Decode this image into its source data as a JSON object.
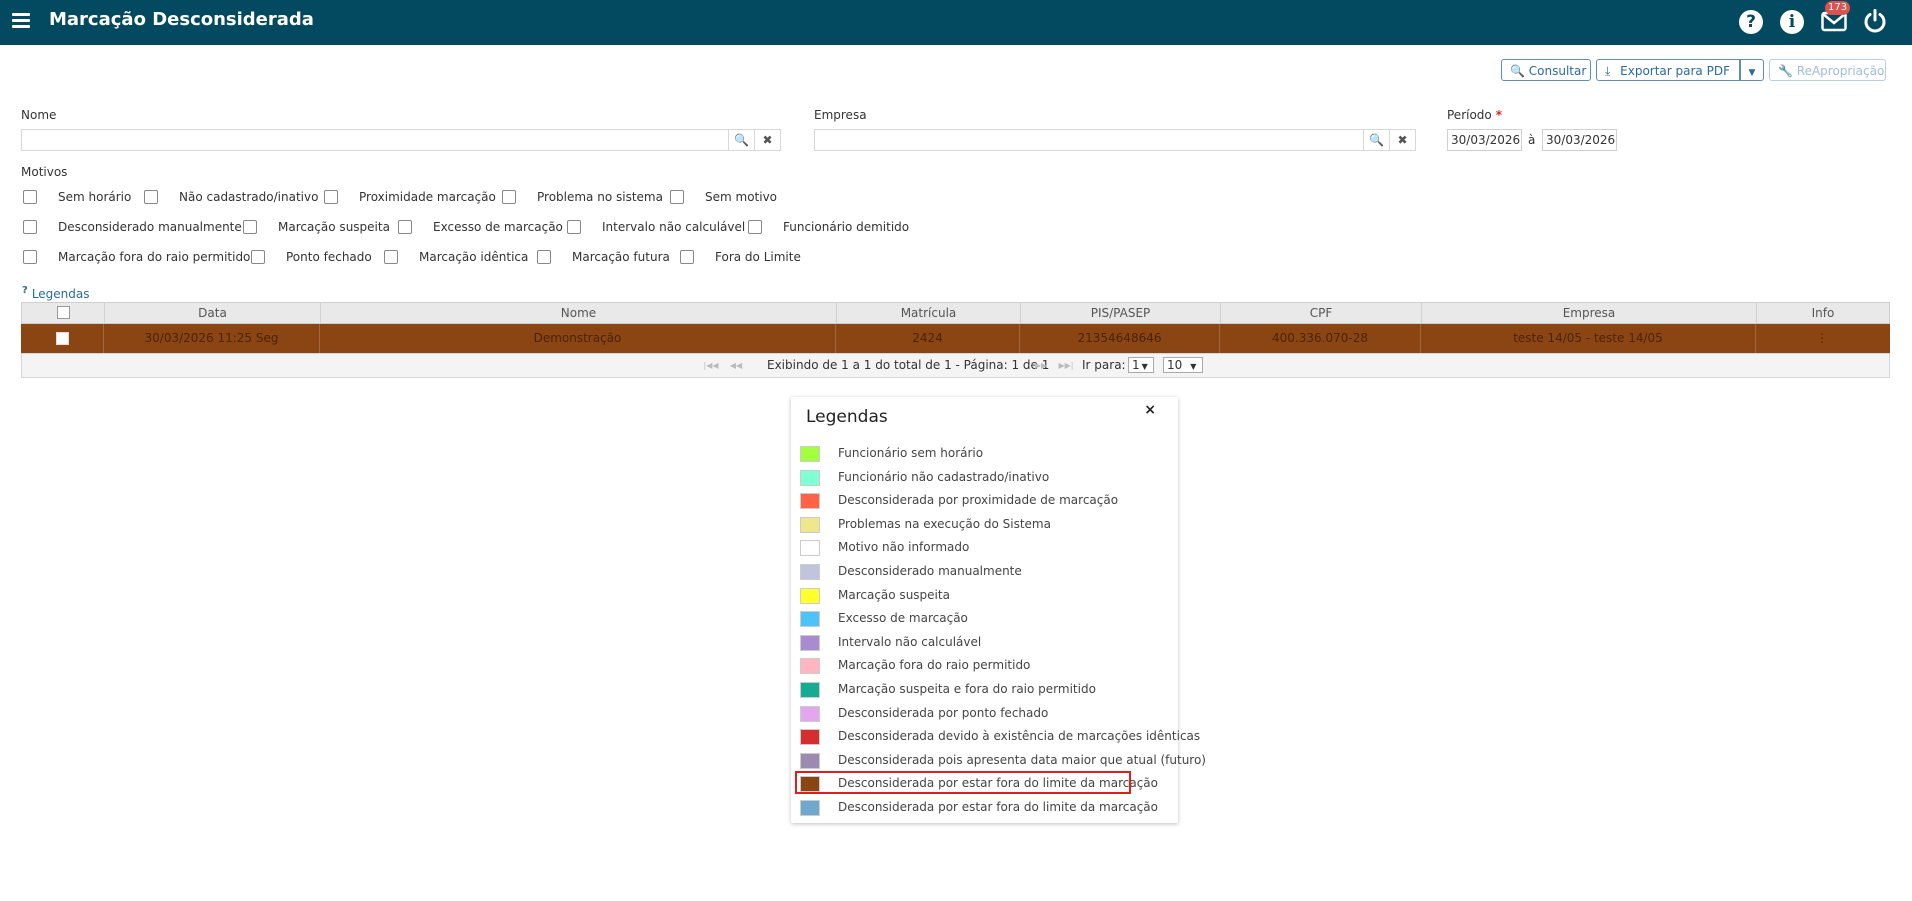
{
  "header": {
    "title": "Marcação Desconsiderada",
    "help_icon": "question-circle-icon",
    "info_icon": "info-circle-icon",
    "mail_icon": "envelope-icon",
    "mail_count": "173",
    "power_icon": "power-icon"
  },
  "toolbar": {
    "consultar": "Consultar",
    "exportar": "Exportar para PDF",
    "reapropriacao": "ReApropriação"
  },
  "filters": {
    "nome_label": "Nome",
    "empresa_label": "Empresa",
    "periodo_label": "Período",
    "periodo_required": "*",
    "date_from": "30/03/2026",
    "date_sep": "à",
    "date_to": "30/03/2026",
    "motivos_label": "Motivos"
  },
  "motivos": [
    [
      "Sem horário",
      "Não cadastrado/inativo",
      "Proximidade marcação",
      "Problema no sistema",
      "Sem motivo"
    ],
    [
      "Desconsiderado manualmente",
      "Marcação suspeita",
      "Excesso de marcação",
      "Intervalo não calculável",
      "Funcionário demitido"
    ],
    [
      "Marcação fora do raio permitido",
      "Ponto fechado",
      "Marcação idêntica",
      "Marcação futura",
      "Fora do Limite"
    ]
  ],
  "legend_link": "Legendas",
  "table": {
    "headers": [
      "Data",
      "Nome",
      "Matrícula",
      "PIS/PASEP",
      "CPF",
      "Empresa",
      "Info"
    ],
    "rows": [
      {
        "data": "30/03/2026 11:25 Seg",
        "nome": "Demonstração",
        "matricula": "2424",
        "pis": "21354648646",
        "cpf": "400.336.070-28",
        "empresa": "teste 14/05 - teste 14/05",
        "info": "⋮",
        "color": "#8b4513"
      }
    ]
  },
  "pager": {
    "summary": "Exibindo de 1 a 1 do total de 1 - Página: 1 de 1",
    "goto_label": "Ir para:",
    "goto_value": "1",
    "page_size": "10"
  },
  "legend_panel": {
    "title": "Legendas",
    "close": "×",
    "items": [
      {
        "label": "Funcionário sem horário",
        "color": "#a3ff3d"
      },
      {
        "label": "Funcionário não cadastrado/inativo",
        "color": "#7fffd4"
      },
      {
        "label": "Desconsiderada por proximidade de marcação",
        "color": "#ff6347"
      },
      {
        "label": "Problemas na execução do Sistema",
        "color": "#f0e68c"
      },
      {
        "label": "Motivo não informado",
        "color": "#ffffff"
      },
      {
        "label": "Desconsiderado manualmente",
        "color": "#c0c4dc"
      },
      {
        "label": "Marcação suspeita",
        "color": "#ffff2b"
      },
      {
        "label": "Excesso de marcação",
        "color": "#4fc3f7"
      },
      {
        "label": "Intervalo não calculável",
        "color": "#a98bd0"
      },
      {
        "label": "Marcação fora do raio permitido",
        "color": "#ffb6c1"
      },
      {
        "label": "Marcação suspeita e fora do raio permitido",
        "color": "#14ad94"
      },
      {
        "label": "Desconsiderada por ponto fechado",
        "color": "#e4a7ef"
      },
      {
        "label": "Desconsiderada devido à existência de marcações idênticas",
        "color": "#d32f2f"
      },
      {
        "label": "Desconsiderada pois apresenta data maior que atual (futuro)",
        "color": "#9c8ab0"
      },
      {
        "label": "Desconsiderada por estar fora do limite da marcação",
        "color": "#8b4513"
      },
      {
        "label": "Desconsiderada por estar fora do limite da marcação",
        "color": "#6fa8cc"
      }
    ]
  }
}
